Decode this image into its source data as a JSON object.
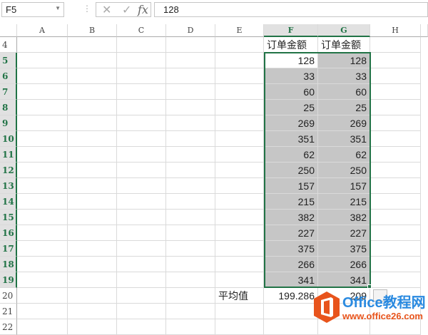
{
  "formula_bar": {
    "name_box": "F5",
    "formula": "128",
    "cancel_icon": "✕",
    "enter_icon": "✓",
    "fx_label": "fx"
  },
  "columns": [
    "A",
    "B",
    "C",
    "D",
    "E",
    "F",
    "G",
    "H"
  ],
  "selected_columns": [
    "F",
    "G"
  ],
  "header_row": {
    "row": "4",
    "F": "订单金额",
    "G": "订单金额"
  },
  "rows": [
    {
      "row": "5",
      "F": "128",
      "G": "128"
    },
    {
      "row": "6",
      "F": "33",
      "G": "33"
    },
    {
      "row": "7",
      "F": "60",
      "G": "60"
    },
    {
      "row": "8",
      "F": "25",
      "G": "25"
    },
    {
      "row": "9",
      "F": "269",
      "G": "269"
    },
    {
      "row": "10",
      "F": "351",
      "G": "351"
    },
    {
      "row": "11",
      "F": "62",
      "G": "62"
    },
    {
      "row": "12",
      "F": "250",
      "G": "250"
    },
    {
      "row": "13",
      "F": "157",
      "G": "157"
    },
    {
      "row": "14",
      "F": "215",
      "G": "215"
    },
    {
      "row": "15",
      "F": "382",
      "G": "382"
    },
    {
      "row": "16",
      "F": "227",
      "G": "227"
    },
    {
      "row": "17",
      "F": "375",
      "G": "375"
    },
    {
      "row": "18",
      "F": "266",
      "G": "266"
    },
    {
      "row": "19",
      "F": "341",
      "G": "341"
    }
  ],
  "summary_row": {
    "row": "20",
    "E": "平均值",
    "F": "199.286",
    "G": "209"
  },
  "extra_rows": [
    "21",
    "22"
  ],
  "watermark": {
    "title": "Office教程网",
    "url": "www.office26.com"
  },
  "colors": {
    "accent": "#217346",
    "selection": "#c6c6c6",
    "logo": "#e8541c"
  }
}
